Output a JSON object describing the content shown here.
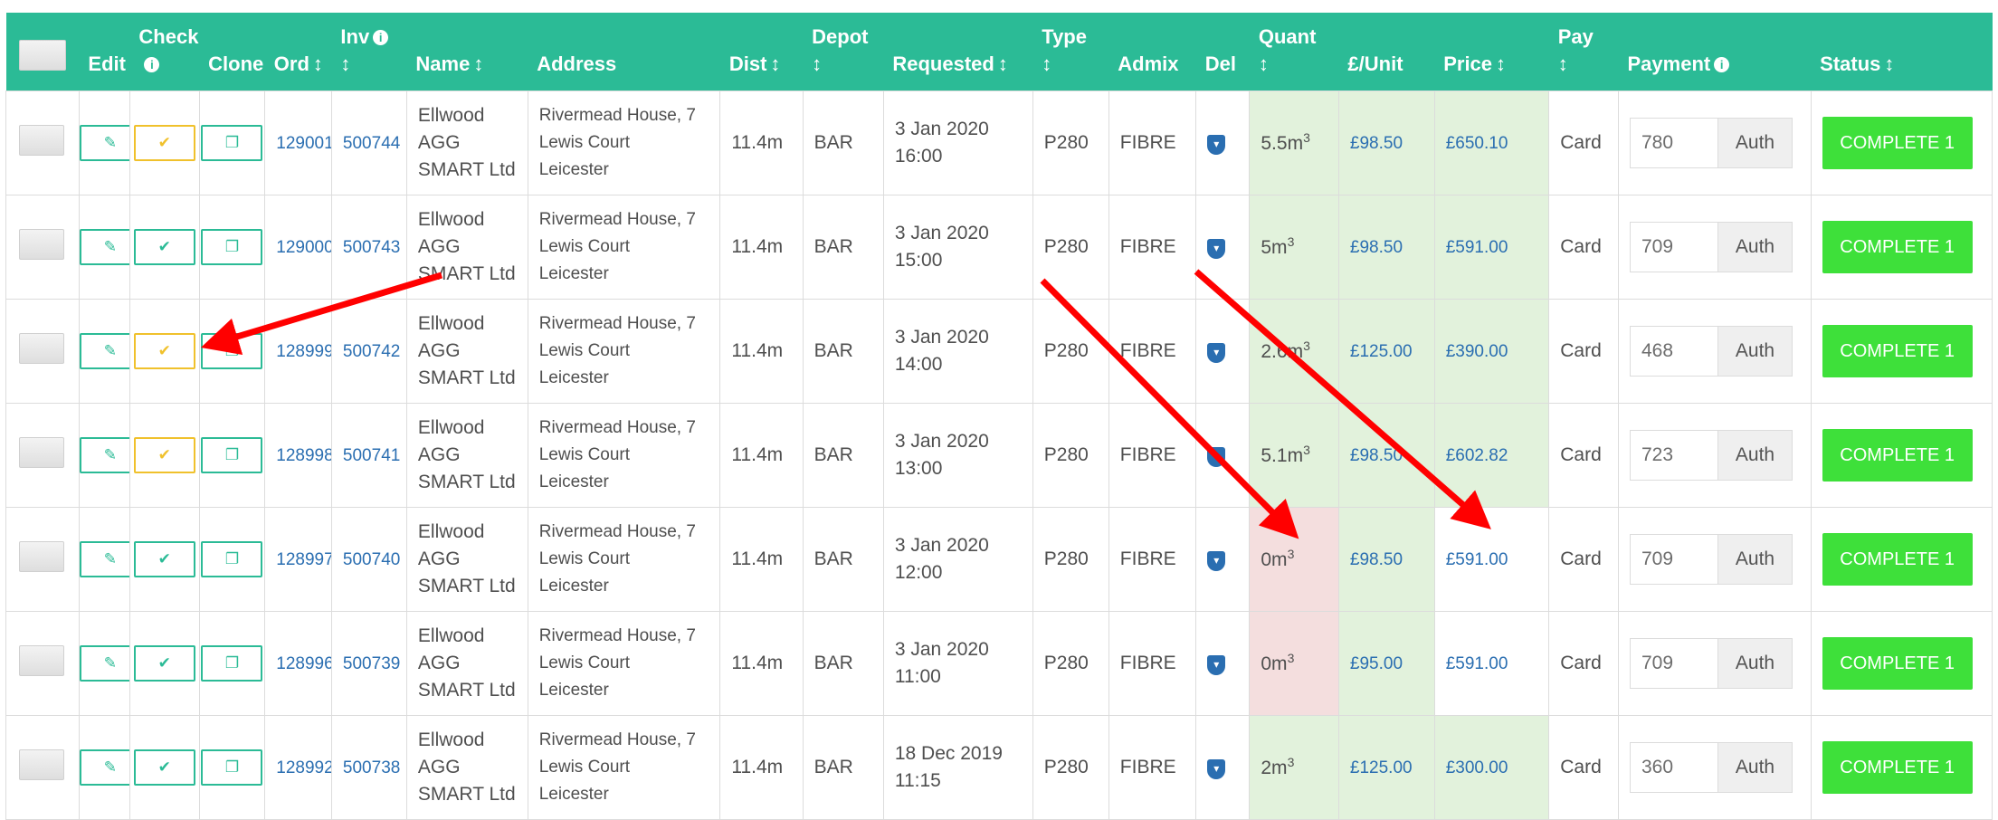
{
  "header": {
    "edit": "Edit",
    "check": "Check",
    "clone": "Clone",
    "ord": "Ord",
    "inv": "Inv",
    "name": "Name",
    "address": "Address",
    "dist": "Dist",
    "depot": "Depot",
    "requested": "Requested",
    "type": "Type",
    "admix": "Admix",
    "del": "Del",
    "quant": "Quant",
    "unit": "£/Unit",
    "price": "Price",
    "pay": "Pay",
    "payment": "Payment",
    "status": "Status",
    "sort_glyph": "↕",
    "info_glyph": "i"
  },
  "rows": [
    {
      "ord": "129001",
      "inv": "500744",
      "name1": "Ellwood",
      "name2": "AGG",
      "name3": "SMART Ltd",
      "addr1": "Rivermead House, 7",
      "addr2": "Lewis Court",
      "addr3": "Leicester",
      "dist": "11.4m",
      "depot": "BAR",
      "req_date": "3 Jan 2020",
      "req_time": "16:00",
      "type": "P280",
      "admix": "FIBRE",
      "quant": "5.5m",
      "unit": "£98.50",
      "price": "£650.10",
      "pay": "Card",
      "payment": "780",
      "auth": "Auth",
      "status": "COMPLETE  1",
      "check_state": "warning"
    },
    {
      "ord": "129000",
      "inv": "500743",
      "name1": "Ellwood",
      "name2": "AGG",
      "name3": "SMART Ltd",
      "addr1": "Rivermead House, 7",
      "addr2": "Lewis Court",
      "addr3": "Leicester",
      "dist": "11.4m",
      "depot": "BAR",
      "req_date": "3 Jan 2020",
      "req_time": "15:00",
      "type": "P280",
      "admix": "FIBRE",
      "quant": "5m",
      "unit": "£98.50",
      "price": "£591.00",
      "pay": "Card",
      "payment": "709",
      "auth": "Auth",
      "status": "COMPLETE  1",
      "check_state": "ok"
    },
    {
      "ord": "128999",
      "inv": "500742",
      "name1": "Ellwood",
      "name2": "AGG",
      "name3": "SMART Ltd",
      "addr1": "Rivermead House, 7",
      "addr2": "Lewis Court",
      "addr3": "Leicester",
      "dist": "11.4m",
      "depot": "BAR",
      "req_date": "3 Jan 2020",
      "req_time": "14:00",
      "type": "P280",
      "admix": "FIBRE",
      "quant": "2.6m",
      "unit": "£125.00",
      "price": "£390.00",
      "pay": "Card",
      "payment": "468",
      "auth": "Auth",
      "status": "COMPLETE  1",
      "check_state": "warning"
    },
    {
      "ord": "128998",
      "inv": "500741",
      "name1": "Ellwood",
      "name2": "AGG",
      "name3": "SMART Ltd",
      "addr1": "Rivermead House, 7",
      "addr2": "Lewis Court",
      "addr3": "Leicester",
      "dist": "11.4m",
      "depot": "BAR",
      "req_date": "3 Jan 2020",
      "req_time": "13:00",
      "type": "P280",
      "admix": "FIBRE",
      "quant": "5.1m",
      "unit": "£98.50",
      "price": "£602.82",
      "pay": "Card",
      "payment": "723",
      "auth": "Auth",
      "status": "COMPLETE  1",
      "check_state": "warning"
    },
    {
      "ord": "128997",
      "inv": "500740",
      "name1": "Ellwood",
      "name2": "AGG",
      "name3": "SMART Ltd",
      "addr1": "Rivermead House, 7",
      "addr2": "Lewis Court",
      "addr3": "Leicester",
      "dist": "11.4m",
      "depot": "BAR",
      "req_date": "3 Jan 2020",
      "req_time": "12:00",
      "type": "P280",
      "admix": "FIBRE",
      "quant": "0m",
      "unit": "£98.50",
      "price": "£591.00",
      "pay": "Card",
      "payment": "709",
      "auth": "Auth",
      "status": "COMPLETE  1",
      "check_state": "ok"
    },
    {
      "ord": "128996",
      "inv": "500739",
      "name1": "Ellwood",
      "name2": "AGG",
      "name3": "SMART Ltd",
      "addr1": "Rivermead House, 7",
      "addr2": "Lewis Court",
      "addr3": "Leicester",
      "dist": "11.4m",
      "depot": "BAR",
      "req_date": "3 Jan 2020",
      "req_time": "11:00",
      "type": "P280",
      "admix": "FIBRE",
      "quant": "0m",
      "unit": "£95.00",
      "price": "£591.00",
      "pay": "Card",
      "payment": "709",
      "auth": "Auth",
      "status": "COMPLETE  1",
      "check_state": "ok"
    },
    {
      "ord": "128992",
      "inv": "500738",
      "name1": "Ellwood",
      "name2": "AGG",
      "name3": "SMART Ltd",
      "addr1": "Rivermead House, 7",
      "addr2": "Lewis Court",
      "addr3": "Leicester",
      "dist": "11.4m",
      "depot": "BAR",
      "req_date": "18 Dec 2019",
      "req_time": "11:15",
      "type": "P280",
      "admix": "FIBRE",
      "quant": "2m",
      "unit": "£125.00",
      "price": "£300.00",
      "pay": "Card",
      "payment": "360",
      "auth": "Auth",
      "status": "COMPLETE  1",
      "check_state": "ok"
    }
  ],
  "quant_unit_sup": "3",
  "icons": {
    "edit": "edit-icon",
    "check": "check-icon",
    "clone": "clone-icon",
    "del": "shield-icon",
    "edit_glyph": "✎",
    "check_glyph": "✔",
    "clone_glyph": "❐",
    "del_glyph": "▾"
  },
  "colors": {
    "header_bg": "#2bbb96",
    "complete_bg": "#3ee03a",
    "check_warning": "#f0c12c",
    "check_ok": "#2bbb96",
    "cell_green": "#e2f2dc",
    "cell_pink": "#f4dede",
    "arrow": "#ff0000"
  }
}
